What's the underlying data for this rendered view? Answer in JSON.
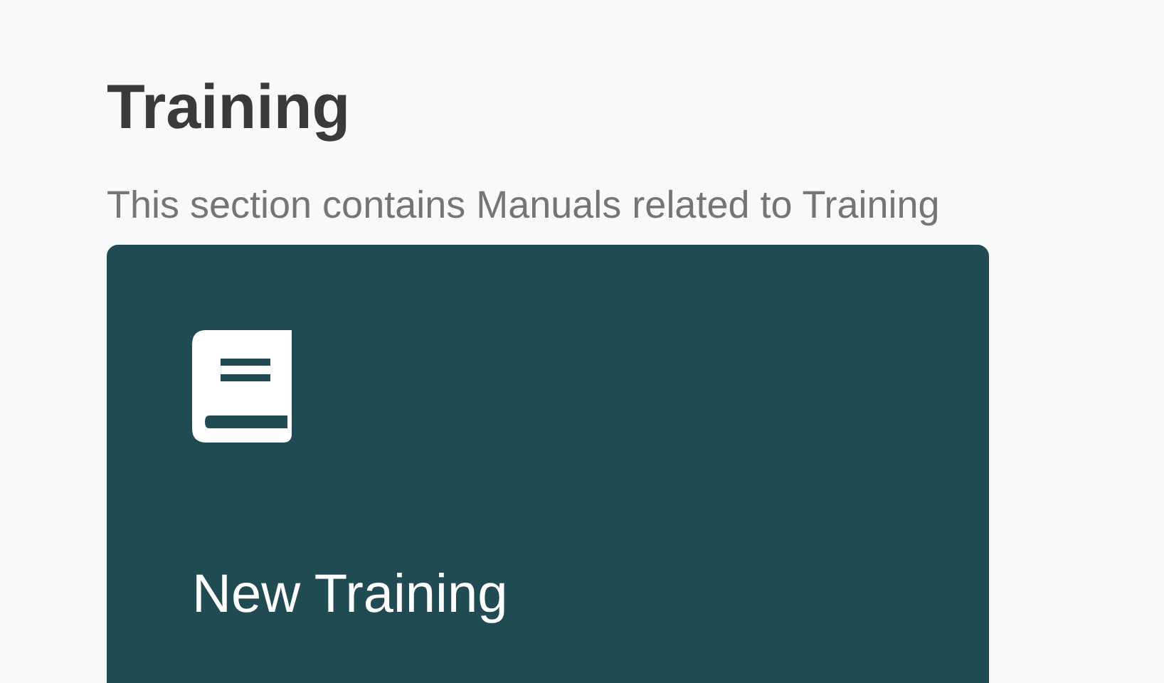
{
  "title": "Training",
  "description": "This section contains Manuals related to Training",
  "cards": [
    {
      "title": "New Training"
    }
  ]
}
